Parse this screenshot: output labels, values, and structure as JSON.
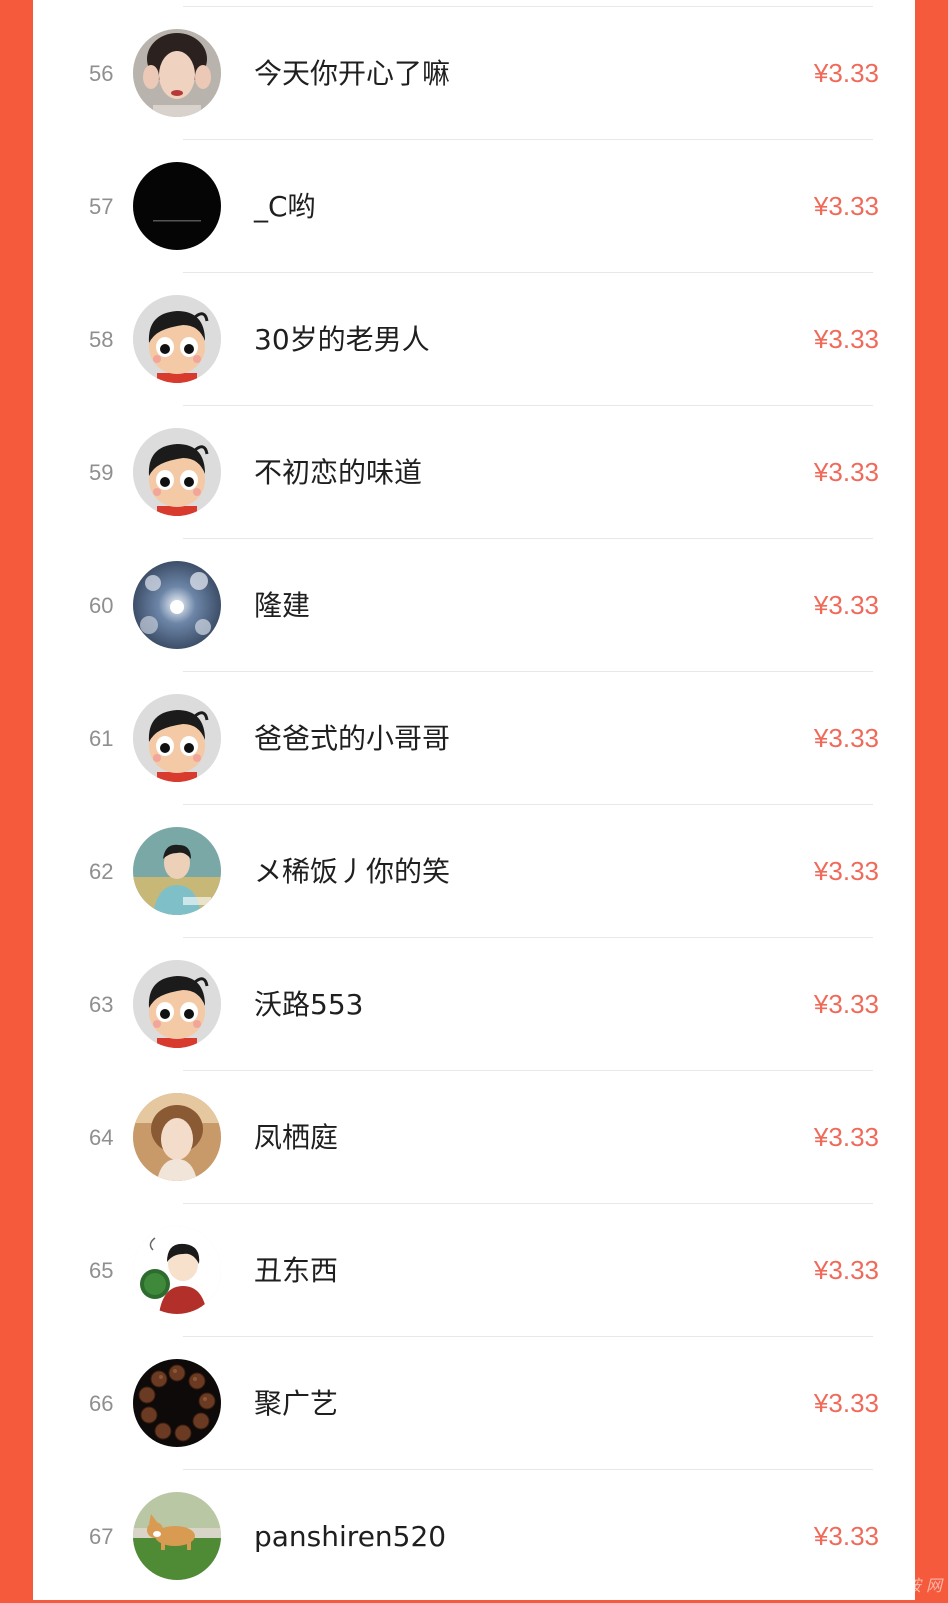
{
  "leaderboard": {
    "rows": [
      {
        "rank": "56",
        "name": "今天你开心了嘛",
        "amount": "¥3.33",
        "avatar": "woman-photo"
      },
      {
        "rank": "57",
        "name": "_C哟",
        "amount": "¥3.33",
        "avatar": "black-image"
      },
      {
        "rank": "58",
        "name": "30岁的老男人",
        "amount": "¥3.33",
        "avatar": "default-cartoon-boy"
      },
      {
        "rank": "59",
        "name": "不初恋的味道",
        "amount": "¥3.33",
        "avatar": "default-cartoon-boy"
      },
      {
        "rank": "60",
        "name": "隆建",
        "amount": "¥3.33",
        "avatar": "blossom-sky-photo"
      },
      {
        "rank": "61",
        "name": "爸爸式的小哥哥",
        "amount": "¥3.33",
        "avatar": "default-cartoon-boy"
      },
      {
        "rank": "62",
        "name": "メ稀饭丿你的笑",
        "amount": "¥3.33",
        "avatar": "young-man-photo"
      },
      {
        "rank": "63",
        "name": "沃路553",
        "amount": "¥3.33",
        "avatar": "default-cartoon-boy"
      },
      {
        "rank": "64",
        "name": "凤栖庭",
        "amount": "¥3.33",
        "avatar": "woman-portrait-photo"
      },
      {
        "rank": "65",
        "name": "丑东西",
        "amount": "¥3.33",
        "avatar": "cartoon-man-watermelon"
      },
      {
        "rank": "66",
        "name": "聚广艺",
        "amount": "¥3.33",
        "avatar": "bead-bracelet-photo"
      },
      {
        "rank": "67",
        "name": "panshiren520",
        "amount": "¥3.33",
        "avatar": "corgi-dog-photo"
      }
    ]
  },
  "colors": {
    "frame": "#F55A3C",
    "amount": "#F06A5A",
    "rank": "#8f8f8f",
    "name": "#1f1f1f"
  }
}
